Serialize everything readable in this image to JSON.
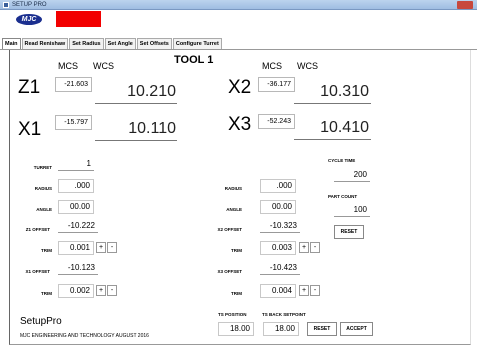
{
  "window": {
    "title": "SETUP PRO"
  },
  "brand": {
    "logo_text": "MJC"
  },
  "tabs": [
    "Main",
    "Read Renishaw",
    "Set Radius",
    "Set Angle",
    "Set Offsets",
    "Configure Turret"
  ],
  "tool_title": "TOOL 1",
  "axes": {
    "mcs_label": "MCS",
    "wcs_label": "WCS",
    "Z1": {
      "label": "Z1",
      "mcs": "-21.603",
      "wcs": "10.210"
    },
    "X1": {
      "label": "X1",
      "mcs": "-15.797",
      "wcs": "10.110"
    },
    "X2": {
      "label": "X2",
      "mcs": "-36.177",
      "wcs": "10.310"
    },
    "X3": {
      "label": "X3",
      "mcs": "-52.243",
      "wcs": "10.410"
    }
  },
  "left": {
    "turret": {
      "label": "TURRET",
      "value": "1"
    },
    "radius": {
      "label": "RADIUS",
      "value": ".000"
    },
    "angle": {
      "label": "ANGLE",
      "value": "00.00"
    },
    "z1_offset": {
      "label": "Z1 OFFSET",
      "value": "-10.222"
    },
    "trim1": {
      "label": "TRIM",
      "value": "0.001"
    },
    "x1_offset": {
      "label": "X1 OFFSET",
      "value": "-10.123"
    },
    "trim2": {
      "label": "TRIM",
      "value": "0.002"
    }
  },
  "right": {
    "radius": {
      "label": "RADIUS",
      "value": ".000"
    },
    "angle": {
      "label": "ANGLE",
      "value": "00.00"
    },
    "x2_offset": {
      "label": "X2 OFFSET",
      "value": "-10.323"
    },
    "trim1": {
      "label": "TRIM",
      "value": "0.003"
    },
    "x3_offset": {
      "label": "X3 OFFSET",
      "value": "-10.423"
    },
    "trim2": {
      "label": "TRIM",
      "value": "0.004"
    }
  },
  "cycle": {
    "cycle_time_label": "CYCLE TIME",
    "cycle_time": "200",
    "part_count_label": "PART COUNT",
    "part_count": "100",
    "reset_label": "RESET"
  },
  "ts": {
    "position_label": "TS POSITION",
    "position": "18.00",
    "back_label": "TS BACK SETPOINT",
    "back": "18.00",
    "reset_label": "RESET",
    "accept_label": "ACCEPT"
  },
  "buttons": {
    "plus": "+",
    "minus": "-"
  },
  "footer": {
    "app_name": "SetupPro",
    "credit": "MJC ENGINEERING AND TECHNOLOGY AUGUST 2016"
  }
}
